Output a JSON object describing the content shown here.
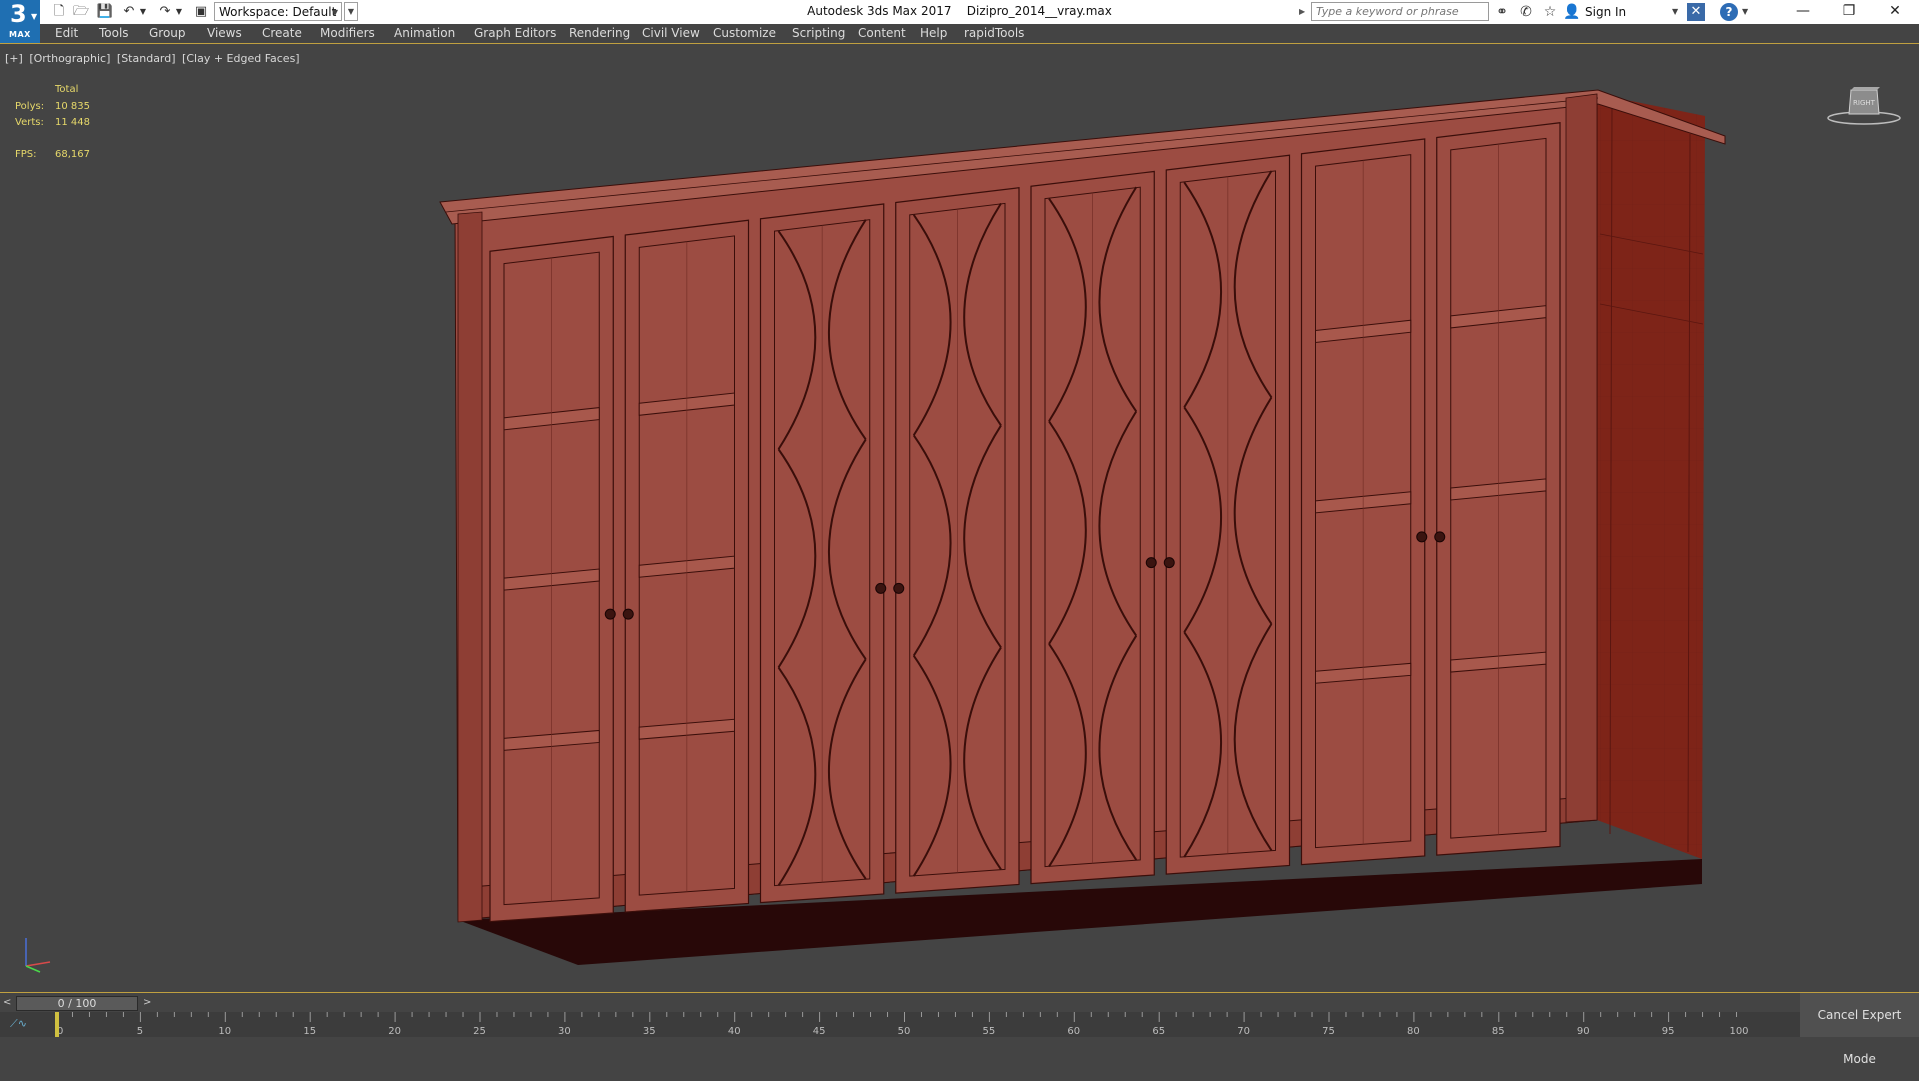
{
  "app": {
    "logo_number": "3",
    "logo_text": "MAX",
    "window_title": "Autodesk 3ds Max 2017    Dizipro_2014__vray.max"
  },
  "quick_access": {
    "icons": [
      "new-file-icon",
      "open-file-icon",
      "save-file-icon",
      "undo-icon",
      "redo-icon",
      "project-folder-icon"
    ],
    "workspace_label": "Workspace: Default"
  },
  "infocenter": {
    "search_placeholder": "Type a keyword or phrase",
    "sign_in": "Sign In"
  },
  "menu": [
    "Edit",
    "Tools",
    "Group",
    "Views",
    "Create",
    "Modifiers",
    "Animation",
    "Graph Editors",
    "Rendering",
    "Civil View",
    "Customize",
    "Scripting",
    "Content",
    "Help",
    "rapidTools"
  ],
  "viewport": {
    "labels": [
      "[+]",
      "[Orthographic]",
      "[Standard]",
      "[Clay + Edged Faces]"
    ],
    "stats": {
      "total_label": "Total",
      "polys_label": "Polys:",
      "polys_value": "10 835",
      "verts_label": "Verts:",
      "verts_value": "11 448",
      "fps_label": "FPS:",
      "fps_value": "68,167"
    },
    "viewcube_label": "RIGHT"
  },
  "timeline": {
    "frame_display": "0 / 100",
    "prev_label": "<",
    "next_label": ">",
    "ticks": [
      "0",
      "5",
      "10",
      "15",
      "20",
      "25",
      "30",
      "35",
      "40",
      "45",
      "50",
      "55",
      "60",
      "65",
      "70",
      "75",
      "80",
      "85",
      "90",
      "95",
      "100"
    ]
  },
  "status": {
    "cancel_expert": "Cancel Expert Mode"
  },
  "colors": {
    "model_face": "#9c4c42",
    "model_side": "#7e2418",
    "model_bottom": "#280808",
    "stats_text": "#e6d86a",
    "accent": "#c0a040"
  }
}
